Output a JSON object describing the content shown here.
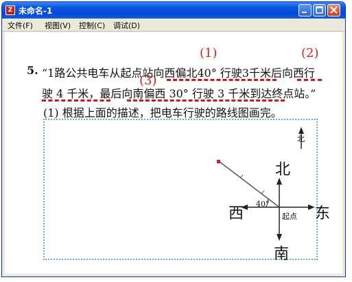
{
  "window": {
    "title": "未命名-1"
  },
  "menu": {
    "items": [
      "文件(F)",
      "视图(V)",
      "控制(C)",
      "调试(D)"
    ]
  },
  "question": {
    "number": "5.",
    "line1": "“1路公共电车从起点站向西偏北40° 行驶3千米后向西行",
    "line2": "驶 4 千米，最后向南偏西 30° 行驶 3 千米到达终点站。”",
    "sub": "(1) 根据上面的描述，把电车行驶的路线图画完。"
  },
  "markers": {
    "m1": "(1)",
    "m2": "(2)",
    "m3": "(3)"
  },
  "diagram": {
    "north": "北",
    "south": "南",
    "east": "东",
    "west": "西",
    "angle": "40°",
    "origin": "起点",
    "compass_north": "北"
  },
  "colors": {
    "title_bar": "#0548d6",
    "marker_red": "#d42020",
    "dash_red": "#c81a1a",
    "box_border": "#6ea8c8"
  }
}
